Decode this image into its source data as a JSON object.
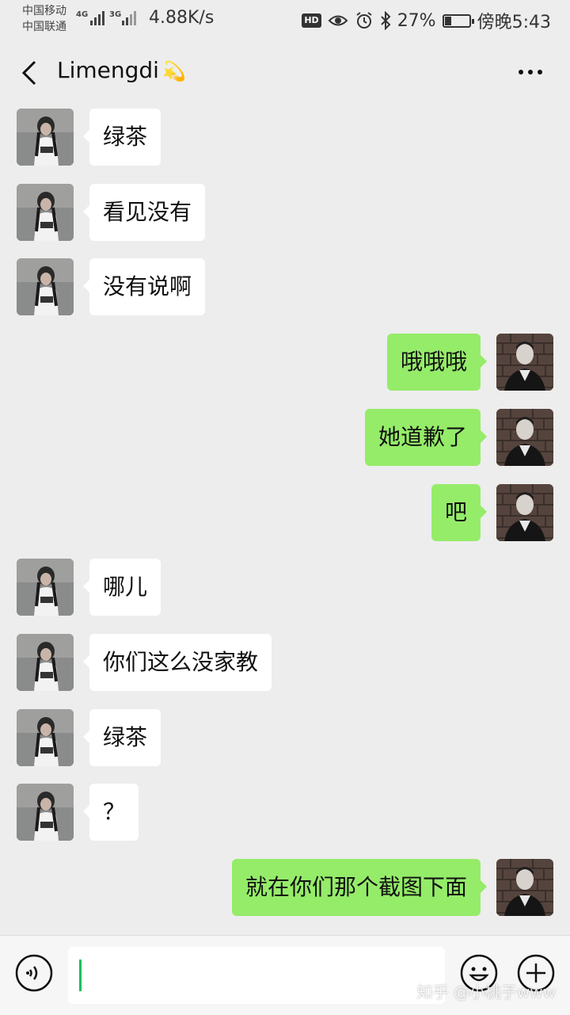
{
  "status": {
    "carrier1": "中国移动",
    "carrier2": "中国联通",
    "net1": "4G",
    "net2": "3G",
    "speed": "4.88K/s",
    "hd": "HD",
    "battery": "27%",
    "battery_level": 0.27,
    "time": "傍晚5:43"
  },
  "header": {
    "title": "Limengdi",
    "title_emoji": "💫"
  },
  "messages": [
    {
      "side": "recv",
      "text": "绿茶"
    },
    {
      "side": "recv",
      "text": "看见没有"
    },
    {
      "side": "recv",
      "text": "没有说啊"
    },
    {
      "side": "sent",
      "text": "哦哦哦"
    },
    {
      "side": "sent",
      "text": "她道歉了"
    },
    {
      "side": "sent",
      "text": "吧"
    },
    {
      "side": "recv",
      "text": "哪儿"
    },
    {
      "side": "recv",
      "text": "你们这么没家教"
    },
    {
      "side": "recv",
      "text": "绿茶"
    },
    {
      "side": "recv",
      "text": "？"
    },
    {
      "side": "sent",
      "text": "就在你们那个截图下面"
    }
  ],
  "input": {
    "value": ""
  },
  "watermark": "知乎 @小桃子www",
  "colors": {
    "background": "#ededed",
    "sent_bubble": "#95ec69",
    "recv_bubble": "#ffffff",
    "caret": "#07c160"
  },
  "icons": [
    "back-arrow-icon",
    "more-dots-icon",
    "voice-icon",
    "emoji-icon",
    "plus-icon",
    "eye-icon",
    "alarm-icon",
    "bluetooth-icon",
    "battery-icon",
    "signal-icon"
  ]
}
